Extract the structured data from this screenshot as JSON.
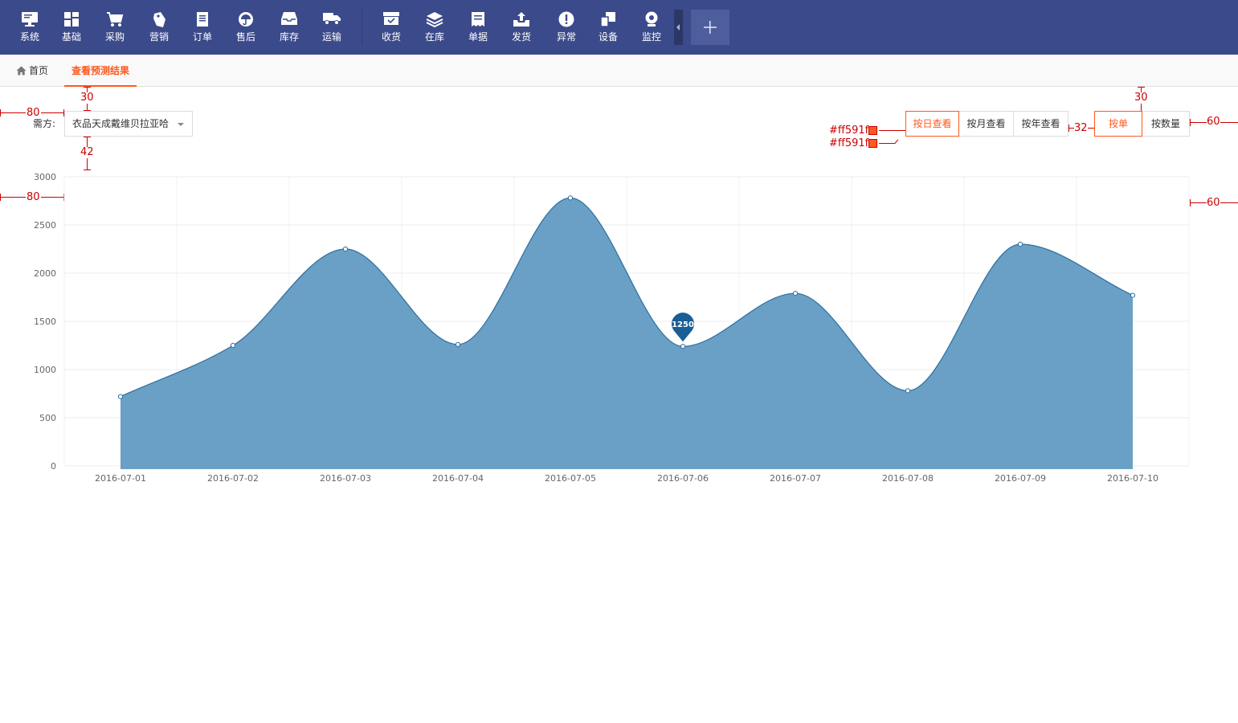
{
  "nav": {
    "group1": [
      {
        "label": "系统",
        "icon": "monitor-icon"
      },
      {
        "label": "基础",
        "icon": "grid-icon"
      },
      {
        "label": "采购",
        "icon": "cart-icon"
      },
      {
        "label": "营销",
        "icon": "tag-icon"
      },
      {
        "label": "订单",
        "icon": "document-icon"
      },
      {
        "label": "售后",
        "icon": "umbrella-icon"
      },
      {
        "label": "库存",
        "icon": "inbox-icon"
      },
      {
        "label": "运输",
        "icon": "truck-icon"
      }
    ],
    "group2": [
      {
        "label": "收货",
        "icon": "receive-box-icon"
      },
      {
        "label": "在库",
        "icon": "layers-icon"
      },
      {
        "label": "单据",
        "icon": "receipt-icon"
      },
      {
        "label": "发货",
        "icon": "upload-tray-icon"
      },
      {
        "label": "异常",
        "icon": "alert-icon"
      },
      {
        "label": "设备",
        "icon": "devices-icon"
      },
      {
        "label": "监控",
        "icon": "webcam-icon"
      }
    ],
    "add_label": "+"
  },
  "tabs": {
    "home": "首页",
    "active": "查看预测结果"
  },
  "filter": {
    "label": "需方:",
    "selected": "衣品天成戴维贝拉亚哈"
  },
  "view_buttons": [
    "按日查看",
    "按月查看",
    "按年查看"
  ],
  "metric_buttons": [
    "按单",
    "按数量"
  ],
  "annotations": {
    "spacing_80": "80",
    "spacing_30": "30",
    "spacing_42": "42",
    "spacing_32": "32",
    "spacing_60": "60",
    "color_note_1": "#ff591f",
    "color_note_2": "#ff591f"
  },
  "chart_data": {
    "type": "area",
    "x": [
      "2016-07-01",
      "2016-07-02",
      "2016-07-03",
      "2016-07-04",
      "2016-07-05",
      "2016-07-06",
      "2016-07-07",
      "2016-07-08",
      "2016-07-09",
      "2016-07-10"
    ],
    "series": [
      {
        "values": [
          720,
          1250,
          2250,
          1260,
          2780,
          1240,
          1790,
          780,
          2300,
          1770
        ]
      }
    ],
    "ylim": [
      0,
      3000
    ],
    "yticks": [
      "0",
      "500",
      "1000",
      "1500",
      "2000",
      "2500",
      "3000"
    ],
    "marker": {
      "label": "1250",
      "x": "2016-07-06"
    },
    "fill_color": "#6aa0c5",
    "line_color": "#2f6f9f",
    "marker_color": "#1a5e95",
    "grid": true
  }
}
